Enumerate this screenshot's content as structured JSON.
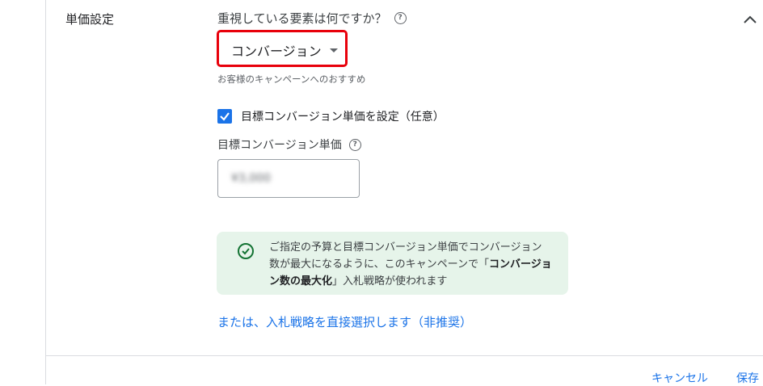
{
  "section": {
    "label": "単価設定"
  },
  "question": {
    "text": "重視している要素は何ですか？",
    "help": "?"
  },
  "dropdown": {
    "selected": "コンバージョン"
  },
  "hint": "お客様のキャンペーンへのおすすめ",
  "checkbox": {
    "label": "目標コンバージョン単価を設定（任意）",
    "checked": true
  },
  "target_cpa": {
    "label": "目標コンバージョン単価",
    "help": "?",
    "value": "¥3,000"
  },
  "info": {
    "text_before": "ご指定の予算と目標コンバージョン単価でコンバージョン数が最大になるように、このキャンペーンで「",
    "strategy": "コンバージョン数の最大化",
    "text_after": "」入札戦略が使われます"
  },
  "alt_link": "または、入札戦略を直接選択します（非推奨）",
  "footer": {
    "cancel": "キャンセル",
    "save": "保存"
  },
  "colors": {
    "accent": "#1a73e8",
    "highlight": "#e8000b",
    "success_bg": "#e6f4ea",
    "success_icon": "#137333"
  }
}
